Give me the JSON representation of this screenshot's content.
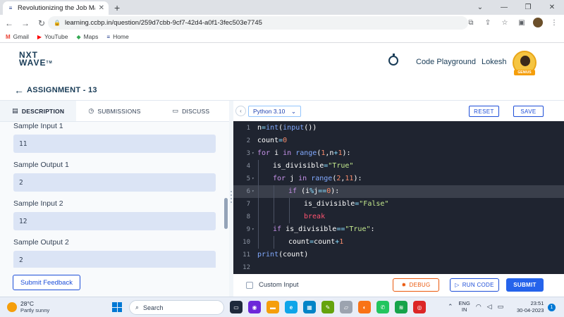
{
  "browser": {
    "tab_title": "Revolutionizing the Job Market | ",
    "url": "learning.ccbp.in/question/259d7cbb-9cf7-42d4-a0f1-3fec503e7745",
    "bookmarks": [
      "Gmail",
      "YouTube",
      "Maps",
      "Home"
    ]
  },
  "header": {
    "logo_line1": "NXT",
    "logo_line2": "WAVE",
    "logo_tm": "TM",
    "code_playground": "Code Playground",
    "username": "Lokesh",
    "badge": "GENIUS"
  },
  "assignment": {
    "title": "ASSIGNMENT - 13"
  },
  "left_panel": {
    "tabs": [
      {
        "label": "DESCRIPTION",
        "icon": "document-icon",
        "active": true
      },
      {
        "label": "SUBMISSIONS",
        "icon": "clock-icon",
        "active": false
      },
      {
        "label": "DISCUSS",
        "icon": "chat-icon",
        "active": false
      }
    ],
    "samples": [
      {
        "label": "Sample Input 1",
        "value": "11"
      },
      {
        "label": "Sample Output 1",
        "value": "2"
      },
      {
        "label": "Sample Input 2",
        "value": "12"
      },
      {
        "label": "Sample Output 2",
        "value": "2"
      }
    ],
    "feedback_label": "Submit Feedback"
  },
  "editor": {
    "language": "Python 3.10",
    "reset_label": "RESET",
    "save_label": "SAVE",
    "highlighted_line": 6,
    "lines": [
      {
        "n": "1",
        "fold": false,
        "indent": 0,
        "tokens": [
          [
            "n",
            "v"
          ],
          [
            "=",
            "o"
          ],
          [
            "int",
            "f"
          ],
          [
            "(",
            "v"
          ],
          [
            "input",
            "f"
          ],
          [
            "())",
            "v"
          ]
        ]
      },
      {
        "n": "2",
        "fold": false,
        "indent": 0,
        "tokens": [
          [
            "count",
            "v"
          ],
          [
            "=",
            "o"
          ],
          [
            "0",
            "n"
          ]
        ]
      },
      {
        "n": "3",
        "fold": true,
        "indent": 0,
        "tokens": [
          [
            "for",
            "k"
          ],
          [
            " i ",
            "v"
          ],
          [
            "in",
            "k"
          ],
          [
            " ",
            "v"
          ],
          [
            "range",
            "f"
          ],
          [
            "(",
            "v"
          ],
          [
            "1",
            "n"
          ],
          [
            ",n",
            "v"
          ],
          [
            "+",
            "o"
          ],
          [
            "1",
            "n"
          ],
          [
            "):",
            "v"
          ]
        ]
      },
      {
        "n": "4",
        "fold": false,
        "indent": 1,
        "tokens": [
          [
            "is_divisible",
            "v"
          ],
          [
            "=",
            "o"
          ],
          [
            "\"True\"",
            "s"
          ]
        ]
      },
      {
        "n": "5",
        "fold": true,
        "indent": 1,
        "tokens": [
          [
            "for",
            "k"
          ],
          [
            " j ",
            "v"
          ],
          [
            "in",
            "k"
          ],
          [
            " ",
            "v"
          ],
          [
            "range",
            "f"
          ],
          [
            "(",
            "v"
          ],
          [
            "2",
            "n"
          ],
          [
            ",",
            "v"
          ],
          [
            "11",
            "n"
          ],
          [
            "):",
            "v"
          ]
        ]
      },
      {
        "n": "6",
        "fold": true,
        "indent": 2,
        "tokens": [
          [
            "if",
            "k"
          ],
          [
            " (i",
            "v"
          ],
          [
            "%",
            "o"
          ],
          [
            "j",
            "v"
          ],
          [
            "==",
            "o"
          ],
          [
            "0",
            "n"
          ],
          [
            "):",
            "v"
          ]
        ]
      },
      {
        "n": "7",
        "fold": false,
        "indent": 3,
        "tokens": [
          [
            "is_divisible",
            "v"
          ],
          [
            "=",
            "o"
          ],
          [
            "\"False\"",
            "s"
          ]
        ]
      },
      {
        "n": "8",
        "fold": false,
        "indent": 3,
        "tokens": [
          [
            "break",
            "kb"
          ]
        ]
      },
      {
        "n": "9",
        "fold": true,
        "indent": 1,
        "tokens": [
          [
            "if",
            "k"
          ],
          [
            " is_divisible",
            "v"
          ],
          [
            "==",
            "o"
          ],
          [
            "\"True\"",
            "s"
          ],
          [
            ":",
            "v"
          ]
        ]
      },
      {
        "n": "10",
        "fold": false,
        "indent": 2,
        "tokens": [
          [
            "count",
            "v"
          ],
          [
            "=",
            "o"
          ],
          [
            "count",
            "v"
          ],
          [
            "+",
            "o"
          ],
          [
            "1",
            "n"
          ]
        ]
      },
      {
        "n": "11",
        "fold": false,
        "indent": 0,
        "tokens": [
          [
            "print",
            "f"
          ],
          [
            "(count)",
            "v"
          ]
        ]
      },
      {
        "n": "12",
        "fold": false,
        "indent": 0,
        "tokens": []
      }
    ]
  },
  "bottom": {
    "custom_input_label": "Custom Input",
    "debug_label": "DEBUG",
    "run_label": "RUN CODE",
    "submit_label": "SUBMIT"
  },
  "taskbar": {
    "temperature": "28°C",
    "weather": "Partly sunny",
    "search_label": "Search",
    "lang_line1": "ENG",
    "lang_line2": "IN",
    "time": "23:51",
    "date": "30-04-2023",
    "notifications": "1"
  },
  "colors": {
    "brand_navy": "#183b56",
    "primary_blue": "#2563eb",
    "debug_orange": "#ea580c",
    "editor_bg": "#1f2430"
  }
}
